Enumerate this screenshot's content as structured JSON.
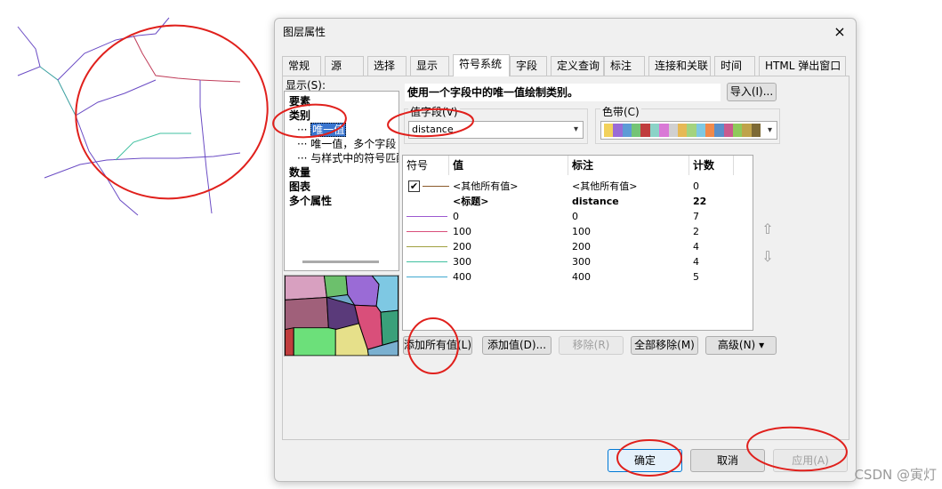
{
  "dialog": {
    "title": "图层属性",
    "close": "×"
  },
  "tabs": [
    "常规",
    "源",
    "选择",
    "显示",
    "符号系统",
    "字段",
    "定义查询",
    "标注",
    "连接和关联",
    "时间",
    "HTML 弹出窗口"
  ],
  "active_tab": "符号系统",
  "show": {
    "label": "显示(S):",
    "tree": {
      "features": "要素",
      "categories": "类别",
      "unique_values": "唯一值",
      "unique_values_many": "唯一值，多个字段",
      "match_style": "与样式中的符号匹配",
      "quantities": "数量",
      "charts": "图表",
      "multiple_attributes": "多个属性"
    }
  },
  "description": "使用一个字段中的唯一值绘制类别。",
  "import_button": "导入(I)...",
  "value_field": {
    "label": "值字段(V)",
    "value": "distance"
  },
  "color_ramp": {
    "label": "色带(C)",
    "colors": [
      "#f2d15b",
      "#9a6bd6",
      "#5d9bd6",
      "#74c476",
      "#c03d3d",
      "#8bd3c7",
      "#d979d6",
      "#d0d0d0",
      "#e6b955",
      "#a3d37f",
      "#7ec8e3",
      "#f08a4b",
      "#5b8fc9",
      "#c95b8f",
      "#8fc95b",
      "#bfa34a",
      "#7d6a35"
    ]
  },
  "table": {
    "headers": {
      "symbol": "符号",
      "value": "值",
      "label": "标注",
      "count": "计数"
    },
    "other": {
      "value": "<其他所有值>",
      "label": "<其他所有值>",
      "count": "0",
      "color": "#8b5a2b"
    },
    "heading": {
      "value": "<标题>",
      "label": "distance",
      "count": "22"
    },
    "rows": [
      {
        "value": "0",
        "label": "0",
        "count": "7",
        "color": "#9b59d0"
      },
      {
        "value": "100",
        "label": "100",
        "count": "2",
        "color": "#d94f7a"
      },
      {
        "value": "200",
        "label": "200",
        "count": "4",
        "color": "#a0a040"
      },
      {
        "value": "300",
        "label": "300",
        "count": "4",
        "color": "#40c0a0"
      },
      {
        "value": "400",
        "label": "400",
        "count": "5",
        "color": "#40a8d0"
      }
    ]
  },
  "buttons": {
    "add_all": "添加所有值(L)",
    "add_value": "添加值(D)...",
    "remove": "移除(R)",
    "remove_all": "全部移除(M)",
    "advanced": "高级(N)",
    "ok": "确定",
    "cancel": "取消",
    "apply": "应用(A)"
  },
  "icons": {
    "up": "arrow-up-icon",
    "down": "arrow-down-icon",
    "check": "✔",
    "caret": "▾"
  },
  "watermark": "CSDN @寅灯",
  "colors": {
    "annotation": "#e0201c",
    "selection": "#3a76d0",
    "primary_border": "#0078d4"
  }
}
